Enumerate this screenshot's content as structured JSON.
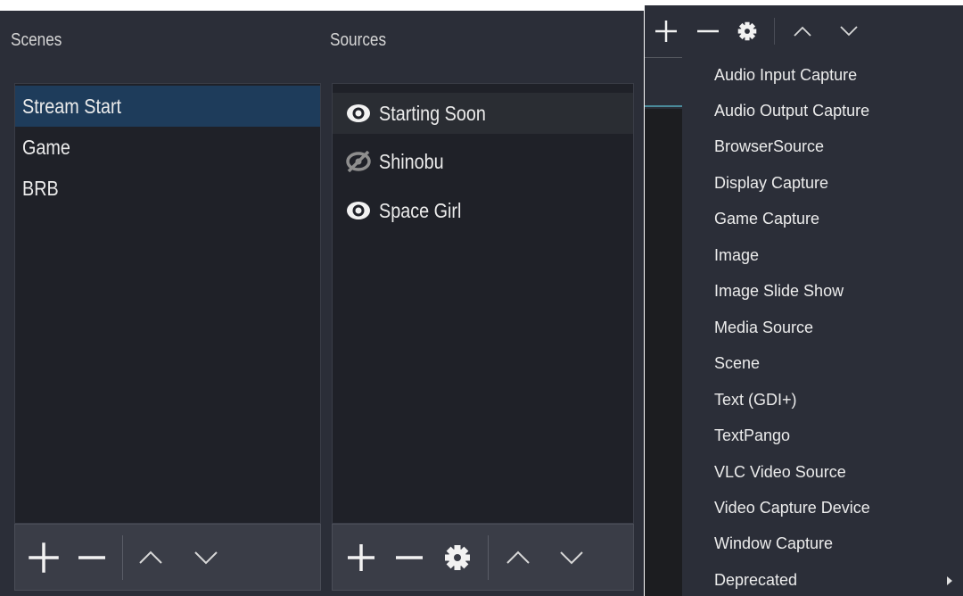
{
  "scenes": {
    "title": "Scenes",
    "items": [
      {
        "label": "Stream Start",
        "selected": true
      },
      {
        "label": "Game",
        "selected": false
      },
      {
        "label": "BRB",
        "selected": false
      }
    ]
  },
  "sources": {
    "title": "Sources",
    "items": [
      {
        "label": "Starting Soon",
        "visible": true,
        "selected": true
      },
      {
        "label": "Shinobu",
        "visible": false,
        "selected": false
      },
      {
        "label": "Space Girl",
        "visible": true,
        "selected": false
      }
    ]
  },
  "add_source_menu": {
    "items": [
      "Audio Input Capture",
      "Audio Output Capture",
      "BrowserSource",
      "Display Capture",
      "Game Capture",
      "Image",
      "Image Slide Show",
      "Media Source",
      "Scene",
      "Text (GDI+)",
      "TextPango",
      "VLC Video Source",
      "Video Capture Device",
      "Window Capture",
      "Deprecated"
    ],
    "submenu_item": "Deprecated"
  },
  "icons": {
    "add": "plus-icon",
    "remove": "minus-icon",
    "properties": "gear-icon",
    "move_up": "chevron-up-icon",
    "move_down": "chevron-down-icon",
    "visible": "eye-icon",
    "hidden": "eye-slash-icon"
  },
  "colors": {
    "panel_bg": "#2b2e38",
    "list_bg": "#1f2128",
    "selection": "#1e3c5b",
    "toolbar_bg": "#3a3d47",
    "text": "#ececec"
  }
}
